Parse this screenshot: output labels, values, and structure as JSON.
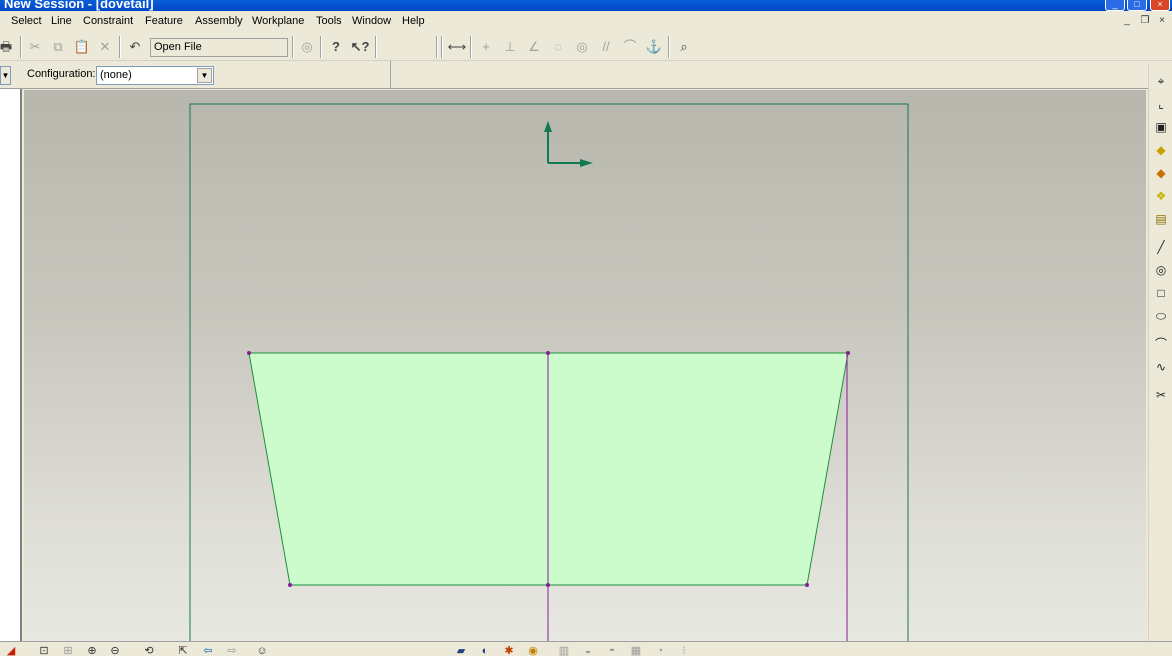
{
  "window": {
    "title": "New Session - [dovetail]"
  },
  "menu": [
    "Select",
    "Line",
    "Constraint",
    "Feature",
    "Assembly",
    "Workplane",
    "Tools",
    "Window",
    "Help"
  ],
  "toolbar": {
    "open_file_label": "Open File",
    "icons": [
      "print-icon",
      "cut-icon",
      "copy-icon",
      "paste-icon",
      "delete-icon",
      "undo-icon",
      "sketch-mode-icon",
      "help-icon",
      "context-help-icon",
      "dimension-icon",
      "horizontal-constraint-icon",
      "perpendicular-constraint-icon",
      "angle-constraint-icon",
      "tangent-constraint-icon",
      "concentric-constraint-icon",
      "parallel-constraint-icon",
      "arc-constraint-icon",
      "fix-constraint-icon",
      "inspect-icon"
    ]
  },
  "config": {
    "label": "Configuration:",
    "value": "(none)"
  },
  "right_toolbar": {
    "icons": [
      "select-icon",
      "select-edge-icon",
      "select-face-icon",
      "select-body-icon",
      "select-solid-icon",
      "select-part-icon",
      "select-assembly-icon",
      "line-tool-icon",
      "circle-tool-icon",
      "rectangle-tool-icon",
      "ellipse-tool-icon",
      "arc-tool-icon",
      "spline-tool-icon",
      "trim-tool-icon"
    ]
  },
  "bottom_toolbar": {
    "icons": [
      "shaded-icon",
      "zoom-fit-icon",
      "zoom-window-icon",
      "zoom-in-icon",
      "zoom-out-icon",
      "rotate-icon",
      "pan-icon",
      "previous-view-icon",
      "next-view-icon",
      "smiley-icon",
      "extrude-icon",
      "revolve-icon",
      "sweep-icon",
      "loft-icon",
      "fillet-icon",
      "chamfer-icon",
      "shell-icon",
      "draft-icon",
      "hole-icon",
      "pattern-icon"
    ]
  },
  "sketch": {
    "profile_color": "#ccfccc",
    "profile_stroke": "#1f8f3a",
    "construction_color": "#8a1a9a",
    "workplane_color": "#127a50",
    "axis_color": "#127a50"
  }
}
